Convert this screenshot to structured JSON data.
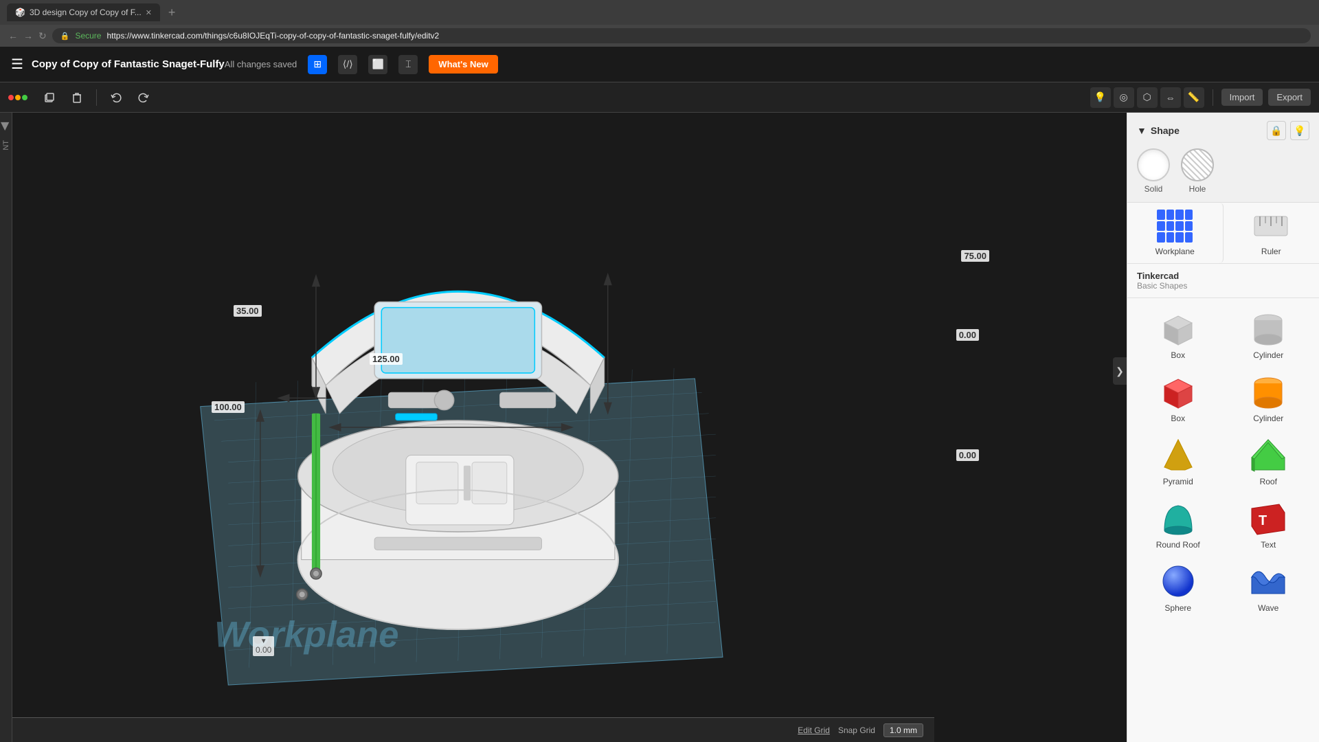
{
  "browser": {
    "tab_title": "3D design Copy of Copy of F...",
    "url": "https://www.tinkercad.com/things/c6u8IOJEqTi-copy-of-copy-of-fantastic-snaget-fulfy/editv2",
    "secure_label": "Secure"
  },
  "app": {
    "title": "Copy of Copy of Fantastic Snaget-Fulfy",
    "save_status": "All changes saved",
    "whats_new_label": "What's New",
    "import_label": "Import",
    "export_label": "Export"
  },
  "toolbar": {
    "duplicate_tooltip": "Duplicate",
    "delete_tooltip": "Delete",
    "undo_tooltip": "Undo",
    "redo_tooltip": "Redo"
  },
  "shape_panel": {
    "title": "Shape",
    "solid_label": "Solid",
    "hole_label": "Hole"
  },
  "library": {
    "source": "Tinkercad",
    "category": "Basic Shapes",
    "workplane_label": "Workplane"
  },
  "shapes": [
    {
      "name": "Box",
      "type": "box-gray"
    },
    {
      "name": "Cylinder",
      "type": "cylinder"
    },
    {
      "name": "Box",
      "type": "box-red"
    },
    {
      "name": "Cylinder",
      "type": "cylinder-orange"
    },
    {
      "name": "Pyramid",
      "type": "pyramid"
    },
    {
      "name": "Roof",
      "type": "roof"
    },
    {
      "name": "Round Roof",
      "type": "roundroof"
    },
    {
      "name": "Text",
      "type": "text-3d"
    },
    {
      "name": "Sphere",
      "type": "sphere"
    },
    {
      "name": "Wave",
      "type": "wave"
    }
  ],
  "dimensions": {
    "d1": "75.00",
    "d2": "35.00",
    "d3": "0.00",
    "d4": "125.00",
    "d5": "100.00",
    "d6": "0.00",
    "z_pos": "0.00"
  },
  "bottom": {
    "edit_grid": "Edit Grid",
    "snap_grid_label": "Snap Grid",
    "snap_grid_value": "1.0 mm"
  },
  "workplane_text": "Workplane"
}
